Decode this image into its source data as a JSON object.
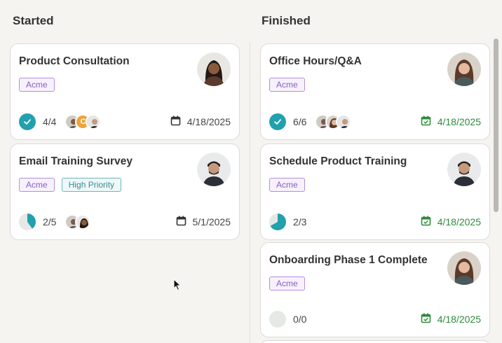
{
  "columns": {
    "started": {
      "title": "Started",
      "cards": [
        {
          "title": "Product Consultation",
          "tags": [
            "Acme"
          ],
          "count": "4/4",
          "date": "4/18/2025"
        },
        {
          "title": "Email Training Survey",
          "tags": [
            "Acme",
            "High Priority"
          ],
          "count": "2/5",
          "date": "5/1/2025"
        }
      ]
    },
    "finished": {
      "title": "Finished",
      "cards": [
        {
          "title": "Office Hours/Q&A",
          "tags": [
            "Acme"
          ],
          "count": "6/6",
          "date": "4/18/2025"
        },
        {
          "title": "Schedule Product Training",
          "tags": [
            "Acme"
          ],
          "count": "2/3",
          "date": "4/18/2025"
        },
        {
          "title": "Onboarding Phase 1 Complete",
          "tags": [
            "Acme"
          ],
          "count": "0/0",
          "date": "4/18/2025"
        }
      ]
    }
  },
  "avatar_initials": "C",
  "colors": {
    "accent": "#22a0ae",
    "success": "#2e8b3a",
    "tag_purple": "#8a5fbf",
    "tag_teal": "#3b8a92"
  },
  "icons": [
    "check-icon",
    "calendar-icon",
    "calendar-check-icon",
    "cursor-icon"
  ]
}
